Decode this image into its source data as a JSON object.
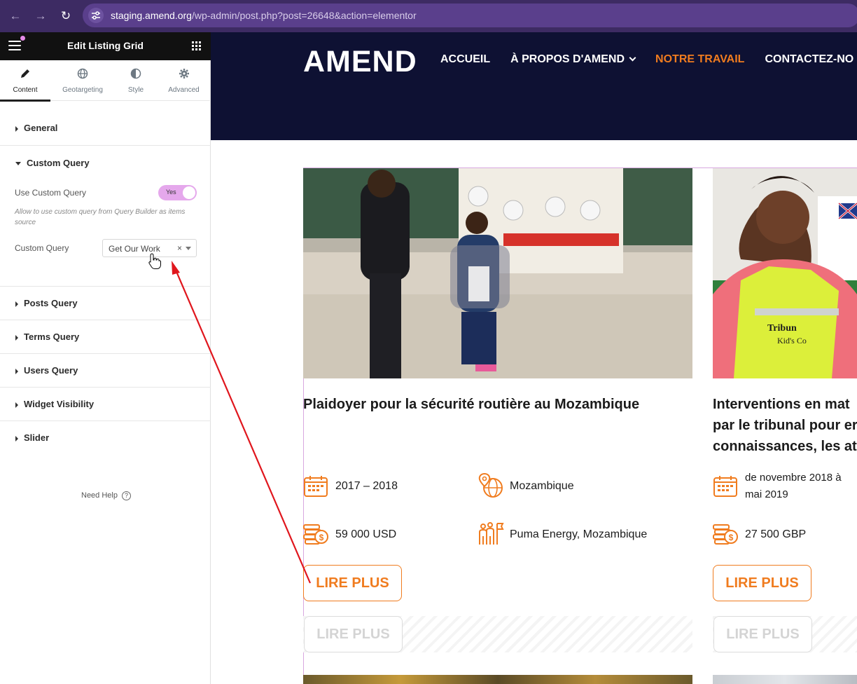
{
  "browser": {
    "url_host": "staging.amend.org",
    "url_path": "/wp-admin/post.php?post=26648&action=elementor"
  },
  "panel": {
    "title": "Edit Listing Grid",
    "tabs": [
      {
        "label": "Content",
        "icon": "pencil-icon"
      },
      {
        "label": "Geotargeting",
        "icon": "globe-icon"
      },
      {
        "label": "Style",
        "icon": "half-circle-icon"
      },
      {
        "label": "Advanced",
        "icon": "gear-icon"
      }
    ],
    "sections": {
      "general": "General",
      "custom_query": "Custom Query",
      "posts_query": "Posts Query",
      "terms_query": "Terms Query",
      "users_query": "Users Query",
      "widget_visibility": "Widget Visibility",
      "slider": "Slider"
    },
    "use_custom_query_label": "Use Custom Query",
    "toggle_label": "Yes",
    "help_text": "Allow to use custom query from Query Builder as items source",
    "custom_query_label": "Custom Query",
    "custom_query_value": "Get Our Work",
    "clear_symbol": "×",
    "need_help": "Need Help",
    "need_help_symbol": "?"
  },
  "site": {
    "logo": "AMEND",
    "nav": [
      "ACCUEIL",
      "À PROPOS D'AMEND",
      "NOTRE TRAVAIL",
      "CONTACTEZ-NO"
    ],
    "cards": [
      {
        "title": "Plaidoyer pour la sécurité routière au Mozambique",
        "dates": "2017 – 2018",
        "location": "Mozambique",
        "budget": "59 000 USD",
        "partners": "Puma Energy, Mozambique",
        "button": "LIRE PLUS",
        "ghost_button": "LIRE PLUS"
      },
      {
        "title": "Interventions en mat par le tribunal pour er connaissances, les att",
        "title_lines": [
          "Interventions en mat",
          "par le tribunal pour er",
          "connaissances, les att"
        ],
        "dates": "de novembre 2018 à mai 2019",
        "dates_lines": [
          "de novembre 2018 à",
          "mai 2019"
        ],
        "budget": "27 500 GBP",
        "button": "LIRE PLUS",
        "ghost_button": "LIRE PLUS"
      }
    ],
    "accent_color": "#f07c1f",
    "header_color": "#0e1133"
  }
}
